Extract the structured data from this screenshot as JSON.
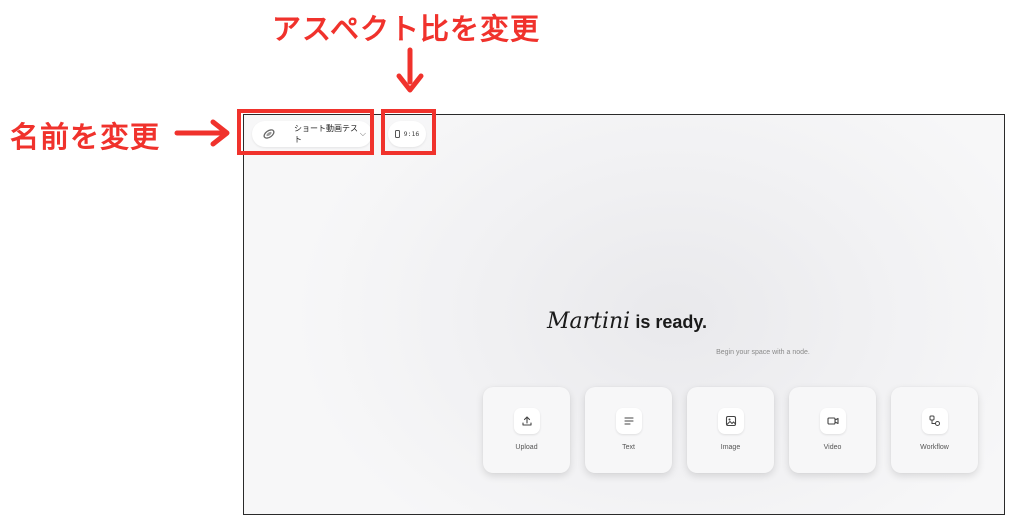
{
  "annotations": {
    "aspect_ratio_label": "アスペクト比を変更",
    "rename_label": "名前を変更",
    "accent_color": "#f0322c"
  },
  "app": {
    "project_name": "ショート動画テスト",
    "project_icon": "logo-icon",
    "aspect_ratio": "9:16",
    "brand": "Martini",
    "ready_text": "is ready.",
    "subtitle": "Begin your space with a node."
  },
  "nodes": [
    {
      "label": "Upload",
      "icon": "upload-icon"
    },
    {
      "label": "Text",
      "icon": "text-lines-icon"
    },
    {
      "label": "Image",
      "icon": "image-icon"
    },
    {
      "label": "Video",
      "icon": "video-camera-icon"
    },
    {
      "label": "Workflow",
      "icon": "workflow-icon"
    }
  ]
}
